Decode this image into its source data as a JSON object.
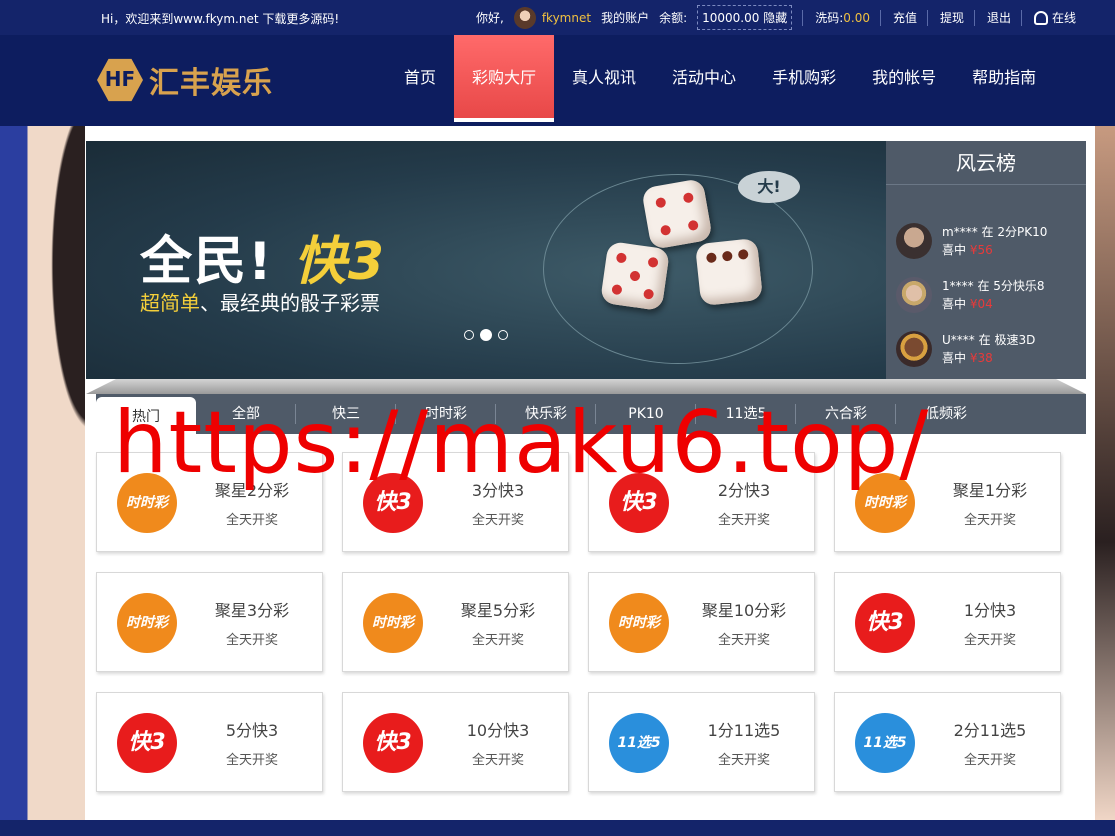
{
  "topbar": {
    "welcome": "Hi，欢迎来到www.fkym.net 下载更多源码!",
    "greeting": "你好,",
    "username": "fkymnet",
    "my_account": "我的账户",
    "balance_label": "余额:",
    "balance_amount": "10000.00",
    "balance_hide": "隐藏",
    "wash_label": "洗码:",
    "wash_amount": "0.00",
    "recharge": "充值",
    "withdraw": "提现",
    "logout": "退出",
    "online_service": "在线"
  },
  "logo": {
    "text": "汇丰娱乐"
  },
  "nav": {
    "items": [
      {
        "label": "首页"
      },
      {
        "label": "彩购大厅"
      },
      {
        "label": "真人视讯"
      },
      {
        "label": "活动中心"
      },
      {
        "label": "手机购彩"
      },
      {
        "label": "我的帐号"
      },
      {
        "label": "帮助指南"
      }
    ],
    "active_index": 1
  },
  "banner": {
    "headline_a": "全民!",
    "headline_b": "快3",
    "sub_highlight": "超简单",
    "sub_rest": "、最经典的骰子彩票",
    "bubble": "大!",
    "slide_count": 3,
    "active_slide": 2
  },
  "ranking": {
    "title": "风云榜",
    "entries": [
      {
        "user": "m****",
        "game": "在 2分PK10",
        "won_label": "喜中",
        "amount": "¥56"
      },
      {
        "user": "1****",
        "game": "在 5分快乐8",
        "won_label": "喜中",
        "amount": "¥04"
      },
      {
        "user": "U****",
        "game": "在 极速3D",
        "won_label": "喜中",
        "amount": "¥38"
      }
    ]
  },
  "tabs": [
    {
      "label": "热门"
    },
    {
      "label": "全部"
    },
    {
      "label": "快三"
    },
    {
      "label": "时时彩"
    },
    {
      "label": "快乐彩"
    },
    {
      "label": "PK10"
    },
    {
      "label": "11选5"
    },
    {
      "label": "六合彩"
    },
    {
      "label": "低频彩"
    }
  ],
  "games": [
    {
      "name": "聚星2分彩",
      "desc": "全天开奖",
      "icon": "ssc"
    },
    {
      "name": "3分快3",
      "desc": "全天开奖",
      "icon": "k3"
    },
    {
      "name": "2分快3",
      "desc": "全天开奖",
      "icon": "k3"
    },
    {
      "name": "聚星1分彩",
      "desc": "全天开奖",
      "icon": "ssc"
    },
    {
      "name": "聚星3分彩",
      "desc": "全天开奖",
      "icon": "ssc"
    },
    {
      "name": "聚星5分彩",
      "desc": "全天开奖",
      "icon": "ssc"
    },
    {
      "name": "聚星10分彩",
      "desc": "全天开奖",
      "icon": "ssc"
    },
    {
      "name": "1分快3",
      "desc": "全天开奖",
      "icon": "k3"
    },
    {
      "name": "5分快3",
      "desc": "全天开奖",
      "icon": "k3"
    },
    {
      "name": "10分快3",
      "desc": "全天开奖",
      "icon": "k3"
    },
    {
      "name": "1分11选5",
      "desc": "全天开奖",
      "icon": "11x5"
    },
    {
      "name": "2分11选5",
      "desc": "全天开奖",
      "icon": "11x5"
    }
  ],
  "icon_labels": {
    "ssc": "时时彩",
    "k3": "快3",
    "11x5": "11选5"
  },
  "watermark": "https://maku6.top/",
  "colors": {
    "nav_bg": "#0d1d5f",
    "active_tab": "#ff6a6a",
    "gold": "#f0c040",
    "ssc": "#f08a1c",
    "k3": "#e81c1c",
    "11x5": "#2a8fdc"
  }
}
